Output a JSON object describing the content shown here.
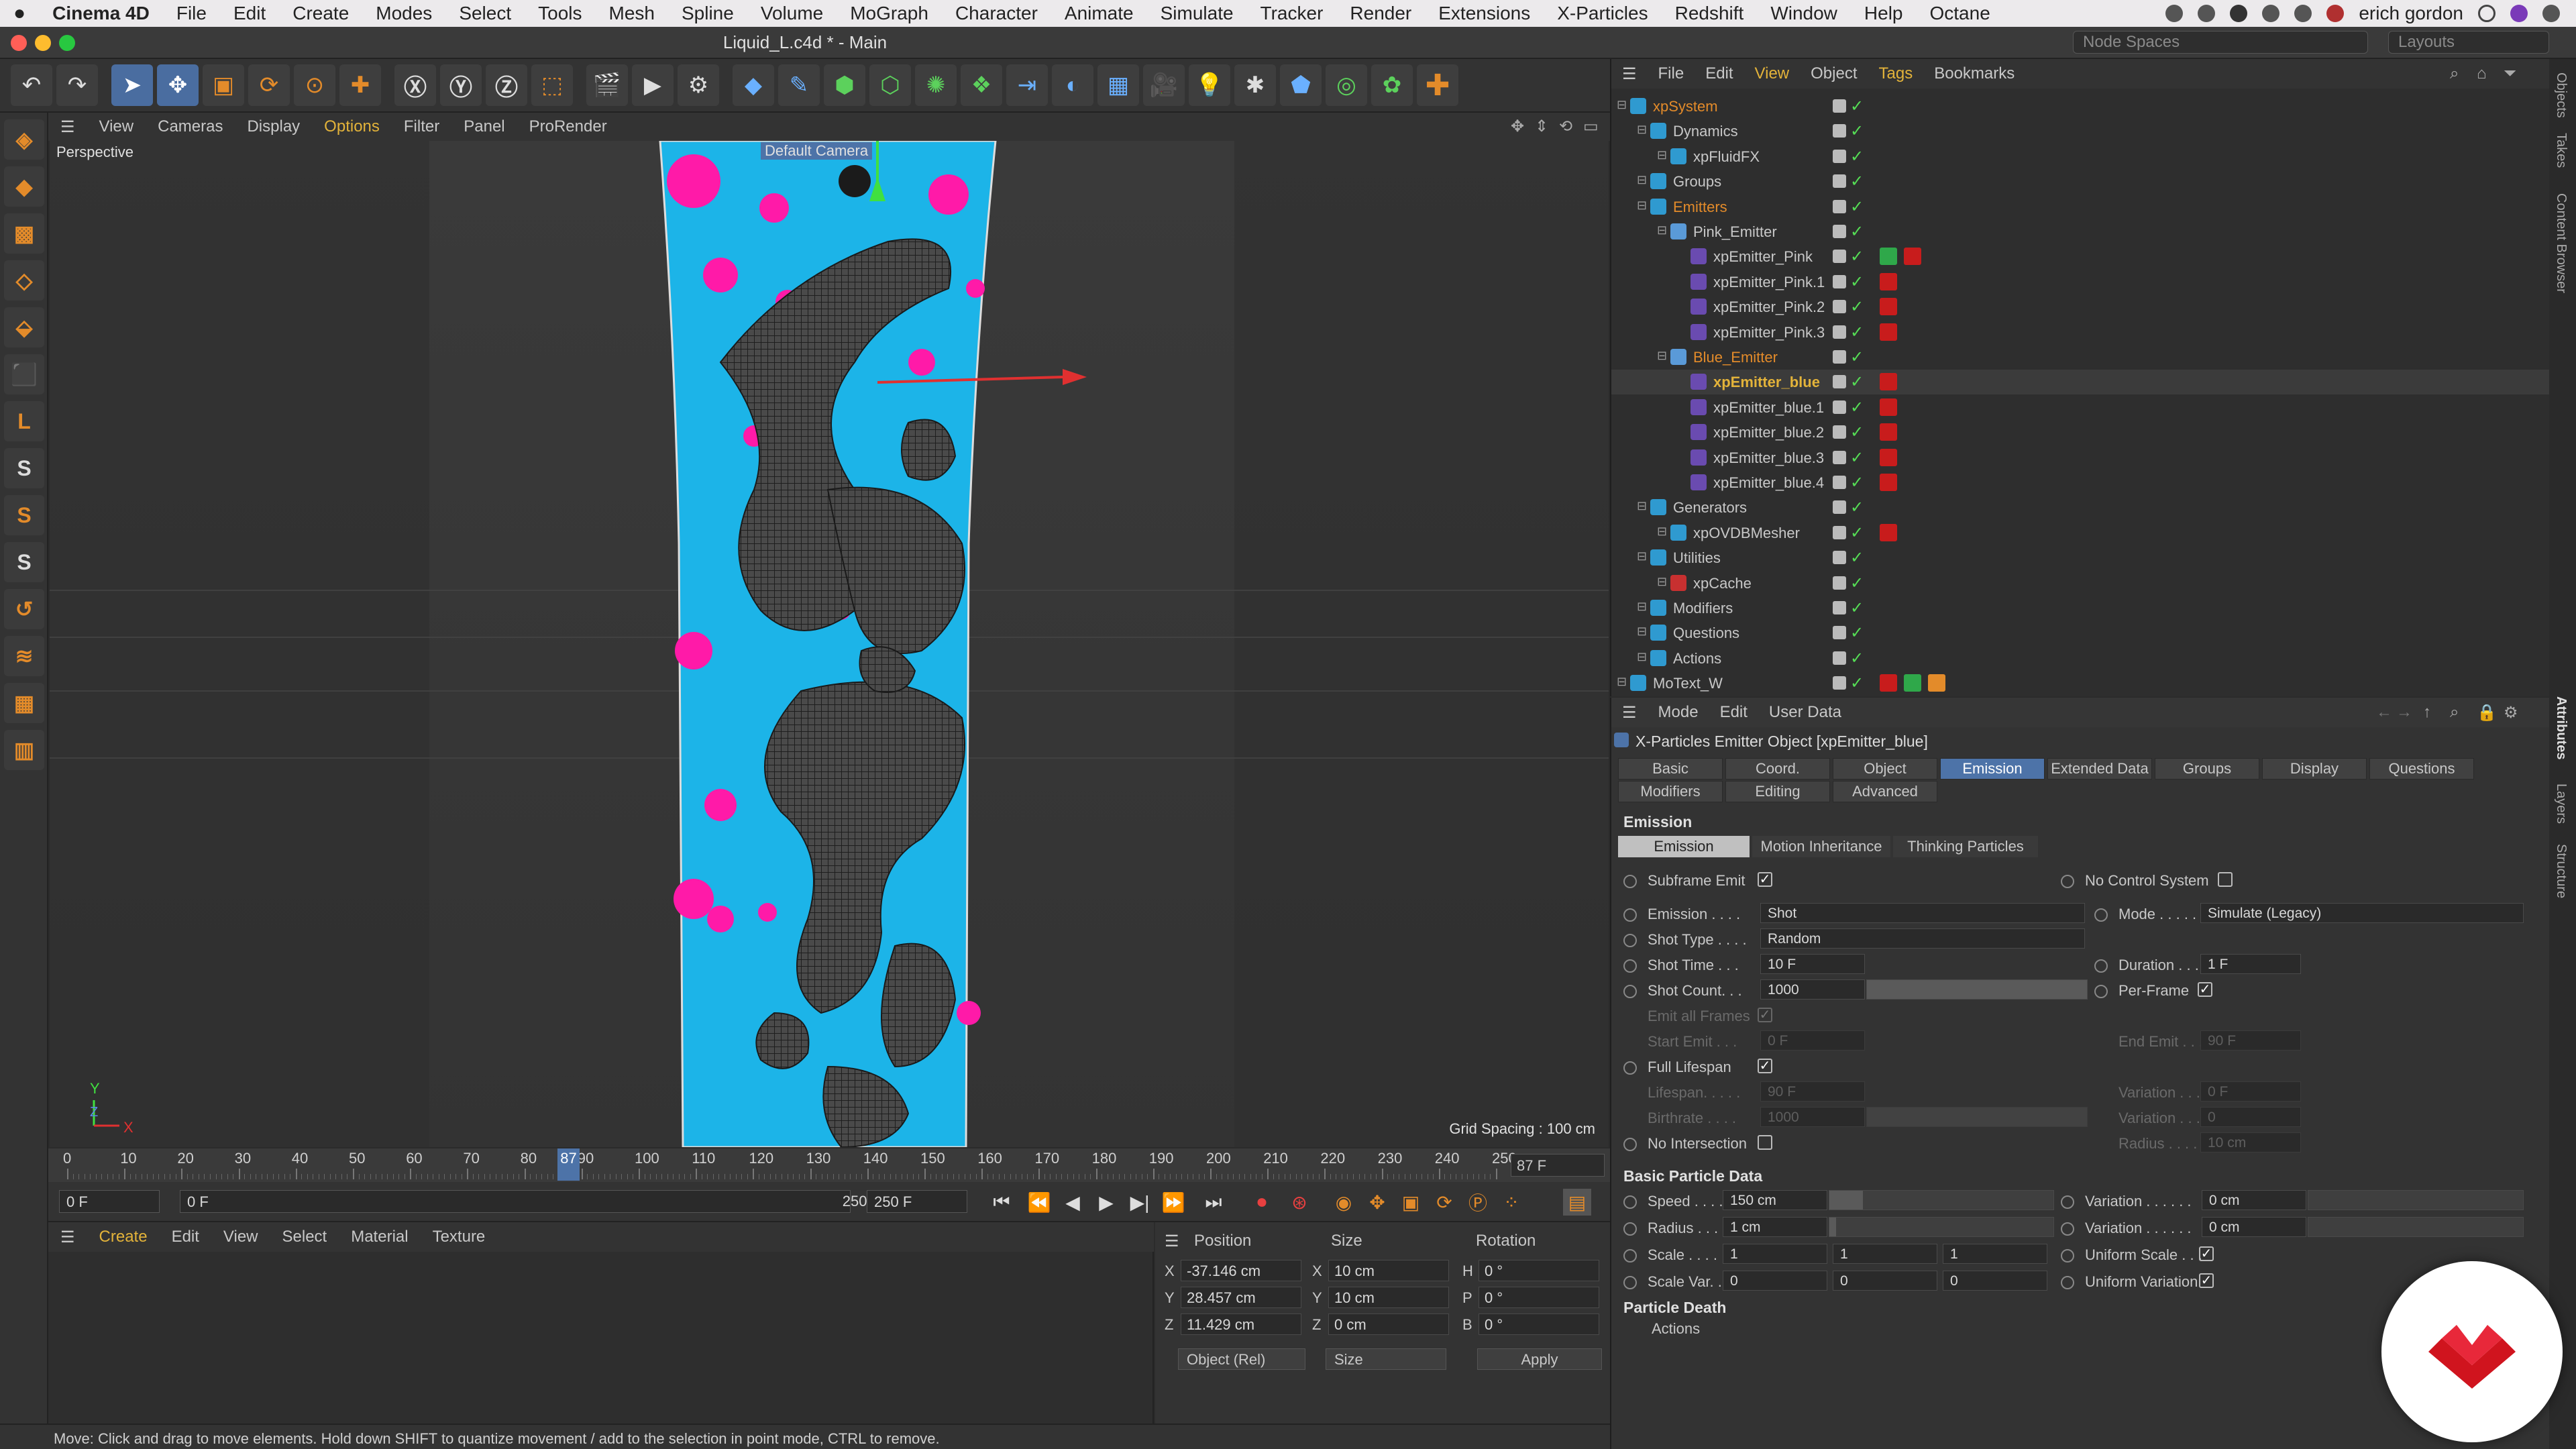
{
  "mac": {
    "app": "Cinema 4D",
    "menus": [
      "File",
      "Edit",
      "Create",
      "Modes",
      "Select",
      "Tools",
      "Mesh",
      "Spline",
      "Volume",
      "MoGraph",
      "Character",
      "Animate",
      "Simulate",
      "Tracker",
      "Render",
      "Extensions",
      "X-Particles",
      "Redshift",
      "Window",
      "Help",
      "Octane"
    ],
    "user": "erich gordon"
  },
  "window": {
    "title": "Liquid_L.c4d * - Main",
    "node_spaces": "Node Spaces",
    "layouts": "Layouts"
  },
  "viewport": {
    "menus": [
      "View",
      "Cameras",
      "Display",
      "Options",
      "Filter",
      "Panel",
      "ProRender"
    ],
    "active_menu": "Options",
    "label": "Perspective",
    "camera": "Default Camera",
    "grid_spacing": "Grid Spacing : 100 cm",
    "colors": {
      "pink": "#ff1aa8",
      "blue": "#1cb4e8",
      "mesh": "#4a4a4a"
    }
  },
  "timeline": {
    "ticks": [
      "0",
      "10",
      "20",
      "30",
      "40",
      "50",
      "60",
      "70",
      "80",
      "90",
      "100",
      "110",
      "120",
      "130",
      "140",
      "150",
      "160",
      "170",
      "180",
      "190",
      "200",
      "210",
      "220",
      "230",
      "240",
      "250"
    ],
    "current_label": "87",
    "frame": "87 F",
    "start": "0 F",
    "start2": "0 F",
    "end": "250 F",
    "end2": "250 F"
  },
  "material": {
    "menus": [
      "Create",
      "Edit",
      "View",
      "Select",
      "Material",
      "Texture"
    ]
  },
  "coords": {
    "headers": {
      "position": "Position",
      "size": "Size",
      "rotation": "Rotation"
    },
    "rows": [
      {
        "axis": "X",
        "pos": "-37.146 cm",
        "saxis": "X",
        "size": "10 cm",
        "raxis": "H",
        "rot": "0 °"
      },
      {
        "axis": "Y",
        "pos": "28.457 cm",
        "saxis": "Y",
        "size": "10 cm",
        "raxis": "P",
        "rot": "0 °"
      },
      {
        "axis": "Z",
        "pos": "11.429 cm",
        "saxis": "Z",
        "size": "0 cm",
        "raxis": "B",
        "rot": "0 °"
      }
    ],
    "mode": "Object (Rel)",
    "size_mode": "Size",
    "apply": "Apply"
  },
  "status": "Move: Click and drag to move elements. Hold down SHIFT to quantize movement / add to the selection in point mode, CTRL to remove.",
  "objects": {
    "menus": [
      "File",
      "Edit",
      "View",
      "Object",
      "Tags",
      "Bookmarks"
    ],
    "active_menu": "View",
    "active_menu2": "Tags",
    "rows": [
      {
        "name": "xpSystem",
        "indent": 0,
        "style": "hl",
        "tags": 0
      },
      {
        "name": "Dynamics",
        "indent": 1,
        "style": "",
        "tags": 0
      },
      {
        "name": "xpFluidFX",
        "indent": 2,
        "style": "",
        "tags": 0
      },
      {
        "name": "Groups",
        "indent": 1,
        "style": "",
        "tags": 0
      },
      {
        "name": "Emitters",
        "indent": 1,
        "style": "hl",
        "tags": 0
      },
      {
        "name": "Pink_Emitter",
        "indent": 2,
        "style": "",
        "tags": 0
      },
      {
        "name": "xpEmitter_Pink",
        "indent": 3,
        "style": "",
        "tags": 2
      },
      {
        "name": "xpEmitter_Pink.1",
        "indent": 3,
        "style": "",
        "tags": 1
      },
      {
        "name": "xpEmitter_Pink.2",
        "indent": 3,
        "style": "",
        "tags": 1
      },
      {
        "name": "xpEmitter_Pink.3",
        "indent": 3,
        "style": "",
        "tags": 1
      },
      {
        "name": "Blue_Emitter",
        "indent": 2,
        "style": "hl",
        "tags": 0
      },
      {
        "name": "xpEmitter_blue",
        "indent": 3,
        "style": "hlb",
        "tags": 1
      },
      {
        "name": "xpEmitter_blue.1",
        "indent": 3,
        "style": "",
        "tags": 1
      },
      {
        "name": "xpEmitter_blue.2",
        "indent": 3,
        "style": "",
        "tags": 1
      },
      {
        "name": "xpEmitter_blue.3",
        "indent": 3,
        "style": "",
        "tags": 1
      },
      {
        "name": "xpEmitter_blue.4",
        "indent": 3,
        "style": "",
        "tags": 1
      },
      {
        "name": "Generators",
        "indent": 1,
        "style": "",
        "tags": 0
      },
      {
        "name": "xpOVDBMesher",
        "indent": 2,
        "style": "",
        "tags": 1
      },
      {
        "name": "Utilities",
        "indent": 1,
        "style": "",
        "tags": 0
      },
      {
        "name": "xpCache",
        "indent": 2,
        "style": "",
        "tags": 0
      },
      {
        "name": "Modifiers",
        "indent": 1,
        "style": "",
        "tags": 0
      },
      {
        "name": "Questions",
        "indent": 1,
        "style": "",
        "tags": 0
      },
      {
        "name": "Actions",
        "indent": 1,
        "style": "",
        "tags": 0
      },
      {
        "name": "MoText_W",
        "indent": 0,
        "style": "",
        "tags": 3
      }
    ]
  },
  "attributes": {
    "menus": [
      "Mode",
      "Edit",
      "User Data"
    ],
    "object_title": "X-Particles Emitter Object [xpEmitter_blue]",
    "tabs_row1": [
      "Basic",
      "Coord.",
      "Object",
      "Emission",
      "Extended Data",
      "Groups",
      "Display",
      "Questions"
    ],
    "tabs_row2": [
      "Modifiers",
      "Editing",
      "Advanced"
    ],
    "active_tab": "Emission",
    "section": "Emission",
    "subtabs": [
      "Emission",
      "Motion Inheritance",
      "Thinking Particles"
    ],
    "active_subtab": "Emission",
    "props": {
      "subframe_emit": "Subframe Emit",
      "no_control_system": "No Control System",
      "emission_label": "Emission . . . .",
      "emission_value": "Shot",
      "mode_label": "Mode . . . . . .",
      "mode_value": "Simulate (Legacy)",
      "shot_type_label": "Shot Type . . . .",
      "shot_type_value": "Random",
      "shot_time_label": "Shot Time . . .",
      "shot_time_value": "10 F",
      "duration_label": "Duration . . . .",
      "duration_value": "1 F",
      "shot_count_label": "Shot Count. . .",
      "shot_count_value": "1000",
      "per_frame": "Per-Frame",
      "emit_all_frames": "Emit all Frames",
      "start_emit_label": "Start Emit . . .",
      "start_emit_value": "0 F",
      "end_emit_label": "End Emit . . . .",
      "end_emit_value": "90 F",
      "full_lifespan": "Full Lifespan",
      "lifespan_label": "Lifespan. . . . .",
      "lifespan_value": "90 F",
      "variation_label": "Variation . . . .",
      "variation_value": "0 F",
      "birthrate_label": "Birthrate . . . .",
      "birthrate_value": "1000",
      "variation2_label": "Variation . . . .",
      "variation2_value": "0",
      "no_intersection": "No Intersection",
      "radius_dim_label": "Radius . . . . .",
      "radius_dim_value": "10 cm"
    },
    "section2": "Basic Particle Data",
    "basic": {
      "speed_label": "Speed . . . . .",
      "speed_value": "150 cm",
      "speed_var_label": "Variation . . . . . .",
      "speed_var_value": "0 cm",
      "radius_label": "Radius . . . . .",
      "radius_value": "1 cm",
      "radius_var_label": "Variation . . . . . .",
      "radius_var_value": "0 cm",
      "scale_label": "Scale . . . . .",
      "scale_x": "1",
      "scale_y": "1",
      "scale_z": "1",
      "uniform_scale": "Uniform Scale . . .",
      "scale_var_label": "Scale Var. . .",
      "scale_var_x": "0",
      "scale_var_y": "0",
      "scale_var_z": "0",
      "uniform_variation": "Uniform Variation"
    },
    "section3": "Particle Death",
    "death_actions": "Actions"
  },
  "side_tabs": [
    "Objects",
    "Takes",
    "Content Browser",
    "Attributes",
    "Layers",
    "Structure"
  ]
}
